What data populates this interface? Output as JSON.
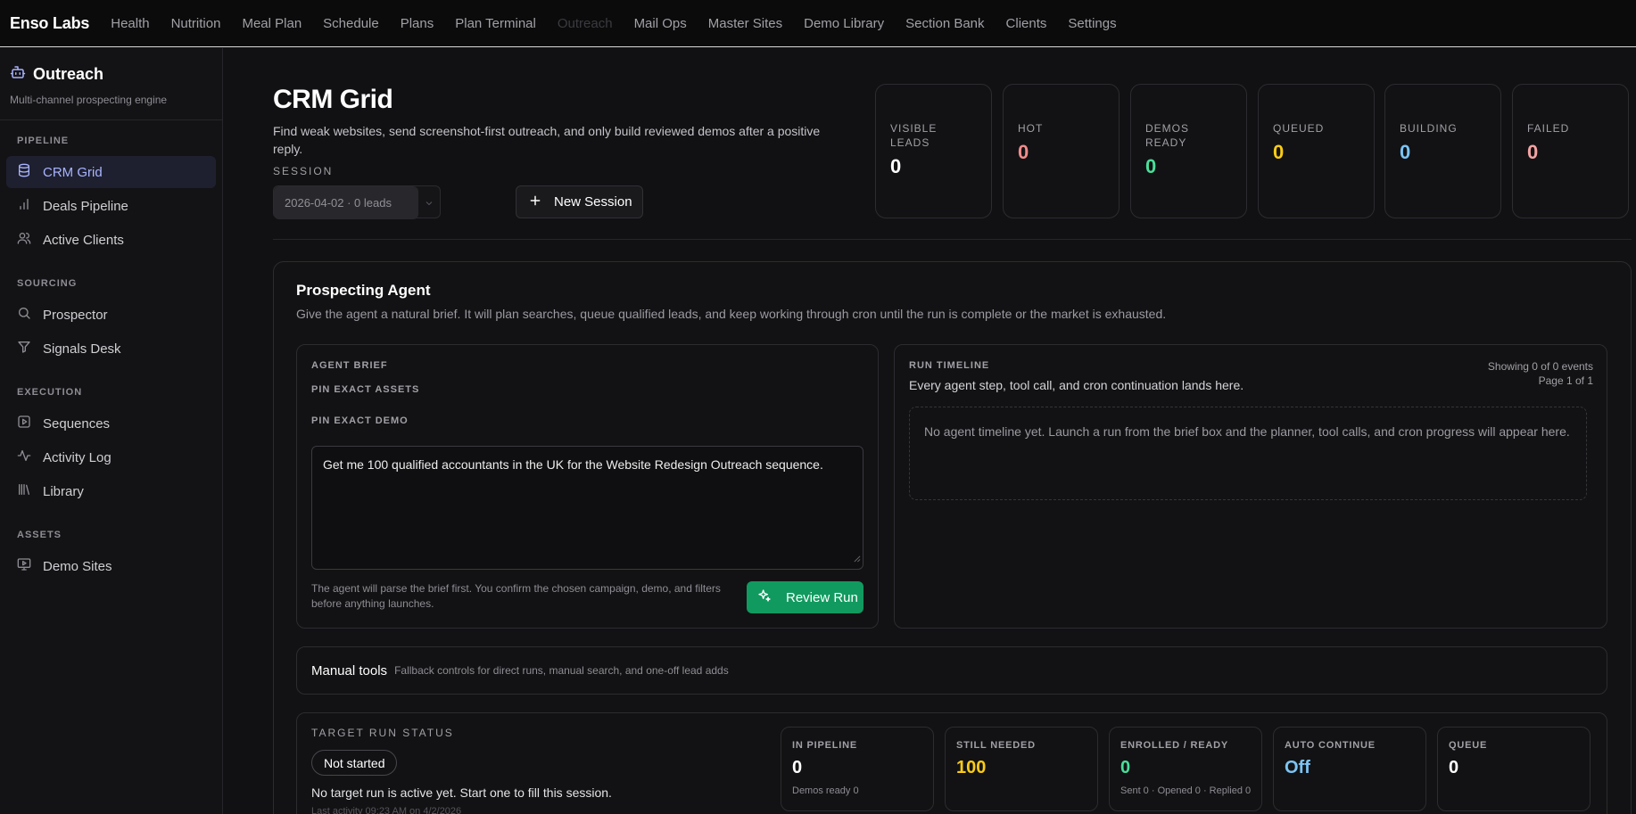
{
  "colors": {
    "accent": "#a9b4ff",
    "hot": "#f28b8b",
    "green": "#4ade9a",
    "yellow": "#facc15",
    "blue": "#7cc4f5",
    "failed": "#f5a3a3",
    "white": "#ffffff",
    "button_green": "#119a5f"
  },
  "topnav": {
    "brand": "Enso Labs",
    "links": [
      "Health",
      "Nutrition",
      "Meal Plan",
      "Schedule",
      "Plans",
      "Plan Terminal",
      "Outreach",
      "Mail Ops",
      "Master Sites",
      "Demo Library",
      "Section Bank",
      "Clients",
      "Settings"
    ],
    "active": "Outreach"
  },
  "sidebar": {
    "title": "Outreach",
    "title_icon": "robot-icon",
    "subtitle": "Multi-channel prospecting engine",
    "sections": [
      {
        "label": "PIPELINE",
        "items": [
          {
            "label": "CRM Grid",
            "icon": "database-icon",
            "active": true
          },
          {
            "label": "Deals Pipeline",
            "icon": "bar-chart-icon"
          },
          {
            "label": "Active Clients",
            "icon": "users-icon"
          }
        ]
      },
      {
        "label": "SOURCING",
        "items": [
          {
            "label": "Prospector",
            "icon": "search-icon"
          },
          {
            "label": "Signals Desk",
            "icon": "filter-icon"
          }
        ]
      },
      {
        "label": "EXECUTION",
        "items": [
          {
            "label": "Sequences",
            "icon": "play-square-icon"
          },
          {
            "label": "Activity Log",
            "icon": "activity-icon"
          },
          {
            "label": "Library",
            "icon": "library-icon"
          }
        ]
      },
      {
        "label": "ASSETS",
        "items": [
          {
            "label": "Demo Sites",
            "icon": "monitor-play-icon"
          }
        ]
      }
    ]
  },
  "header": {
    "title": "CRM Grid",
    "description": "Find weak websites, send screenshot-first outreach, and only build reviewed demos after a positive reply.",
    "session_label": "SESSION",
    "session_value": "2026-04-02 · 0 leads",
    "new_session_label": "New Session"
  },
  "stats": [
    {
      "label": "VISIBLE LEADS",
      "value": "0",
      "color": "#ffffff"
    },
    {
      "label": "HOT",
      "value": "0",
      "color": "#f28b8b"
    },
    {
      "label": "DEMOS READY",
      "value": "0",
      "color": "#4ade9a"
    },
    {
      "label": "QUEUED",
      "value": "0",
      "color": "#facc15"
    },
    {
      "label": "BUILDING",
      "value": "0",
      "color": "#7cc4f5"
    },
    {
      "label": "FAILED",
      "value": "0",
      "color": "#f5a3a3"
    }
  ],
  "agent": {
    "title": "Prospecting Agent",
    "description": "Give the agent a natural brief. It will plan searches, queue qualified leads, and keep working through cron until the run is complete or the market is exhausted.",
    "brief": {
      "label": "AGENT BRIEF",
      "pin_assets_label": "PIN EXACT ASSETS",
      "pin_demo_label": "PIN EXACT DEMO",
      "textarea_value": "Get me 100 qualified accountants in the UK for the Website Redesign Outreach sequence.",
      "note": "The agent will parse the brief first. You confirm the chosen campaign, demo, and filters before anything launches.",
      "review_button": "Review Run"
    },
    "timeline": {
      "label": "RUN TIMELINE",
      "description": "Every agent step, tool call, and cron continuation lands here.",
      "showing": "Showing 0 of 0 events",
      "page": "Page 1 of 1",
      "empty": "No agent timeline yet. Launch a run from the brief box and the planner, tool calls, and cron progress will appear here."
    },
    "manual": {
      "title": "Manual tools",
      "description": "Fallback controls for direct runs, manual search, and one-off lead adds"
    },
    "target_run": {
      "label": "TARGET RUN STATUS",
      "badge": "Not started",
      "message": "No target run is active yet. Start one to fill this session.",
      "last_activity": "Last activity 09:23 AM on 4/2/2026",
      "stats": [
        {
          "label": "IN PIPELINE",
          "value": "0",
          "sub": "Demos ready 0",
          "color": "#ffffff"
        },
        {
          "label": "STILL NEEDED",
          "value": "100",
          "sub": "",
          "color": "#facc15"
        },
        {
          "label": "ENROLLED / READY",
          "value": "0",
          "sub": "Sent 0 · Opened 0 · Replied 0",
          "color": "#4ade9a"
        },
        {
          "label": "AUTO CONTINUE",
          "value": "Off",
          "sub": "",
          "color": "#7cc4f5"
        },
        {
          "label": "QUEUE",
          "value": "0",
          "sub": "",
          "color": "#ffffff"
        }
      ]
    }
  }
}
